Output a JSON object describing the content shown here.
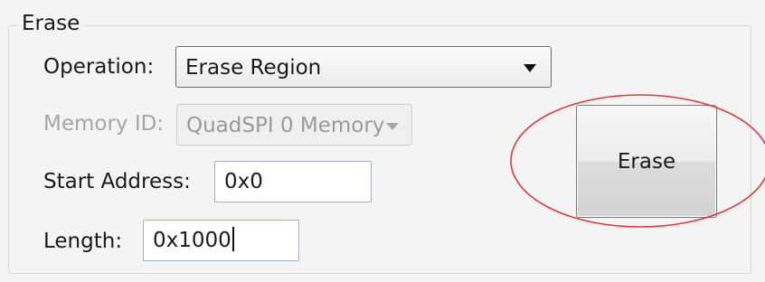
{
  "erase_group": {
    "title": "Erase",
    "operation": {
      "label": "Operation:",
      "selected": "Erase Region"
    },
    "memory_id": {
      "label": "Memory ID:",
      "selected": "QuadSPI 0 Memory"
    },
    "start_address": {
      "label": "Start Address:",
      "value": "0x0"
    },
    "length": {
      "label": "Length:",
      "value": "0x1000"
    },
    "erase_button_label": "Erase"
  },
  "colors": {
    "highlight_ellipse": "#e0393f",
    "input_border": "#9ab3cc",
    "disabled_text": "#a6a6a6"
  },
  "icons": {
    "dropdown": "chevron-down-icon"
  }
}
